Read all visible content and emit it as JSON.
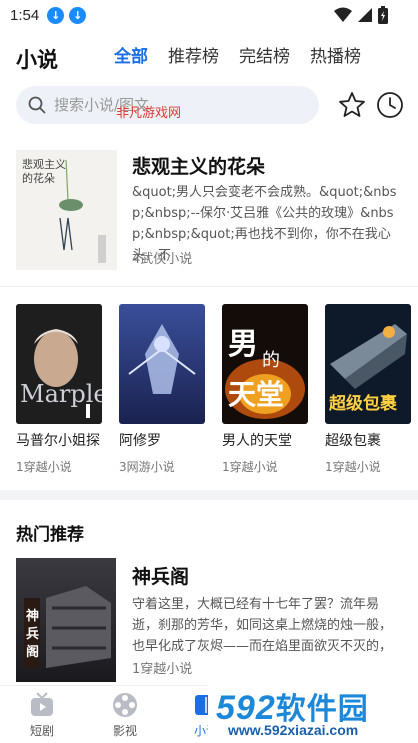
{
  "status_bar": {
    "time": "1:54"
  },
  "header": {
    "title": "小说",
    "tabs": [
      {
        "label": "全部",
        "active": true
      },
      {
        "label": "推荐榜",
        "active": false
      },
      {
        "label": "完结榜",
        "active": false
      },
      {
        "label": "热播榜",
        "active": false
      }
    ]
  },
  "search": {
    "placeholder": "搜索小说/图文"
  },
  "watermark_top": "非凡游戏网",
  "featured": {
    "title": "悲观主义的花朵",
    "description": "&quot;男人只会变老不会成熟。&quot;&nbsp;&nbsp;--保尔·艾吕雅《公共的玫瑰》&nbsp;&nbsp;&quot;再也找不到你，你不在我心头，不",
    "meta": "4武侠小说",
    "cover_text": "悲观主义的花朵"
  },
  "books": [
    {
      "name": "马普尔小姐探",
      "meta": "1穿越小说",
      "cover_text": "Marple"
    },
    {
      "name": "阿修罗",
      "meta": "3网游小说",
      "cover_text": ""
    },
    {
      "name": "男人的天堂",
      "meta": "1穿越小说",
      "cover_text": "男人的天堂"
    },
    {
      "name": "超级包裹",
      "meta": "1穿越小说",
      "cover_text": "超级包裹"
    }
  ],
  "hot_section": {
    "title": "热门推荐",
    "item": {
      "title": "神兵阁",
      "description": "守着这里，大概已经有十七年了罢？流年易逝，刹那的芳华，如同这桌上燃烧的烛一般，也早化成了灰烬——而在焰里面欲灭不灭的，只是过去",
      "meta": "1穿越小说",
      "cover_text": "神兵阁"
    }
  },
  "bottom_nav": [
    {
      "label": "短剧"
    },
    {
      "label": "影视"
    },
    {
      "label": "小说"
    }
  ],
  "site_watermark": {
    "logo_num": "592",
    "logo_text": "软件园",
    "url": "www.592xiazai.com"
  },
  "colors": {
    "accent": "#1a6fe6",
    "download_badge": "#1a8cff",
    "watermark_red": "#e03a2f"
  }
}
